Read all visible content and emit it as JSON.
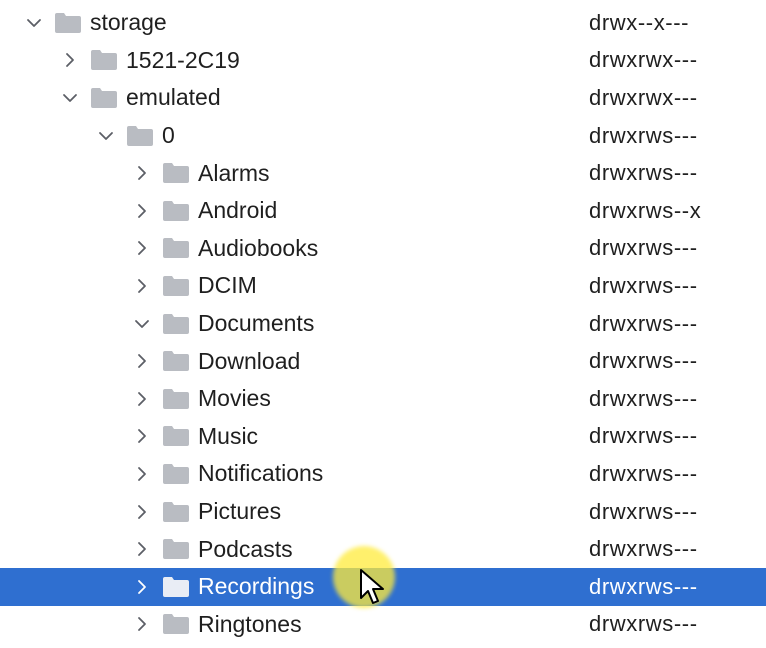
{
  "tree": [
    {
      "name": "storage",
      "perm": "drwx--x---",
      "level": 0,
      "expanded": true
    },
    {
      "name": "1521-2C19",
      "perm": "drwxrwx---",
      "level": 1,
      "expanded": false
    },
    {
      "name": "emulated",
      "perm": "drwxrwx---",
      "level": 1,
      "expanded": true
    },
    {
      "name": "0",
      "perm": "drwxrws---",
      "level": 2,
      "expanded": true
    },
    {
      "name": "Alarms",
      "perm": "drwxrws---",
      "level": 3,
      "expanded": false
    },
    {
      "name": "Android",
      "perm": "drwxrws--x",
      "level": 3,
      "expanded": false
    },
    {
      "name": "Audiobooks",
      "perm": "drwxrws---",
      "level": 3,
      "expanded": false
    },
    {
      "name": "DCIM",
      "perm": "drwxrws---",
      "level": 3,
      "expanded": false
    },
    {
      "name": "Documents",
      "perm": "drwxrws---",
      "level": 3,
      "expanded": true
    },
    {
      "name": "Download",
      "perm": "drwxrws---",
      "level": 3,
      "expanded": false
    },
    {
      "name": "Movies",
      "perm": "drwxrws---",
      "level": 3,
      "expanded": false
    },
    {
      "name": "Music",
      "perm": "drwxrws---",
      "level": 3,
      "expanded": false
    },
    {
      "name": "Notifications",
      "perm": "drwxrws---",
      "level": 3,
      "expanded": false
    },
    {
      "name": "Pictures",
      "perm": "drwxrws---",
      "level": 3,
      "expanded": false
    },
    {
      "name": "Podcasts",
      "perm": "drwxrws---",
      "level": 3,
      "expanded": false
    },
    {
      "name": "Recordings",
      "perm": "drwxrws---",
      "level": 3,
      "expanded": false,
      "selected": true
    },
    {
      "name": "Ringtones",
      "perm": "drwxrws---",
      "level": 3,
      "expanded": false
    }
  ],
  "colors": {
    "selection": "#2f6fd0",
    "folder": "#b9bcc2",
    "chevron": "#5c5f66"
  },
  "icons": {
    "folder": "folder-icon",
    "collapsed": "chevron-right-icon",
    "expanded": "chevron-down-icon",
    "cursor": "mouse-pointer-icon"
  }
}
